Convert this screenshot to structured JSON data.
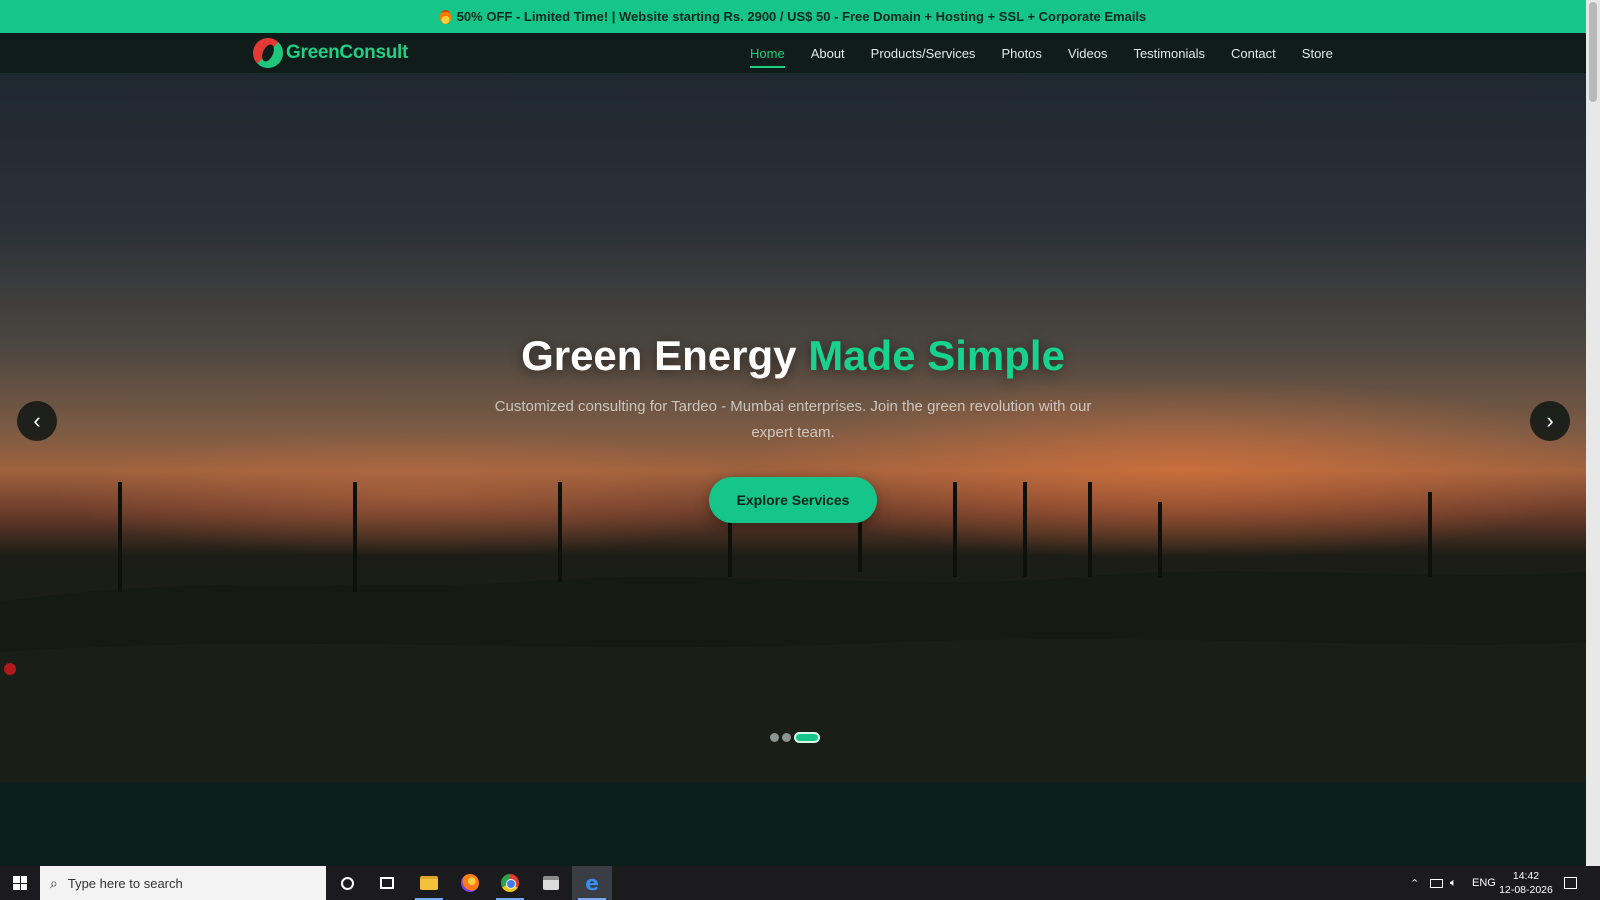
{
  "promo": {
    "text": "50% OFF - Limited Time! | Website starting Rs. 2900 / US$ 50 - Free Domain + Hosting + SSL + Corporate Emails",
    "icon": "fire-icon"
  },
  "nav": {
    "logo_text": "GreenConsult",
    "items": [
      {
        "label": "Home",
        "active": true
      },
      {
        "label": "About"
      },
      {
        "label": "Products/Services"
      },
      {
        "label": "Photos"
      },
      {
        "label": "Videos"
      },
      {
        "label": "Testimonials"
      },
      {
        "label": "Contact"
      },
      {
        "label": "Store"
      }
    ]
  },
  "hero": {
    "title_main": "Green Energy",
    "title_accent": "Made Simple",
    "subtitle": "Customized consulting for Tardeo - Mumbai enterprises. Join the green revolution with our expert team.",
    "cta_label": "Explore Services",
    "prev_arrow": "‹",
    "next_arrow": "›",
    "slide_count": 3,
    "active_slide": 3
  },
  "taskbar": {
    "search_placeholder": "Type here to search",
    "language": "ENG",
    "time": "14:42",
    "date": "12-08-2026"
  },
  "colors": {
    "accent": "#15c58a",
    "nav_bg": "#0f1c1a"
  }
}
